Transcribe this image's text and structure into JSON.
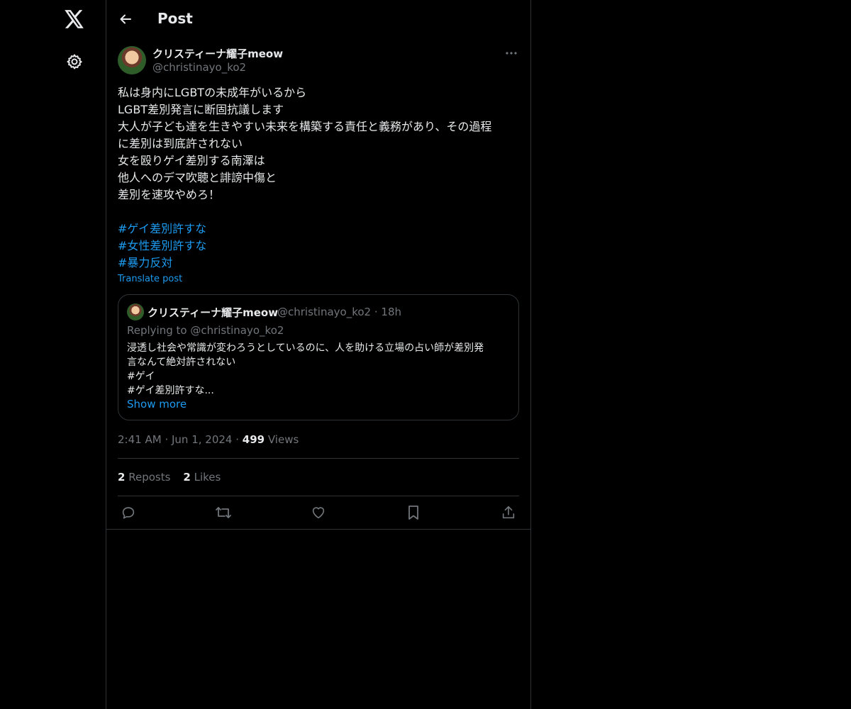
{
  "nav": {
    "logo_icon": "x-logo-icon",
    "settings_icon": "gear-icon"
  },
  "header": {
    "back_icon": "arrow-left-icon",
    "title": "Post"
  },
  "post": {
    "author_name": "クリスティーナ耀子meow",
    "author_handle": "@christinayo_ko2",
    "more_icon": "more-horizontal-icon",
    "lines": [
      "私は身内にLGBTの未成年がいるから",
      "LGBT差別発言に断固抗議します",
      "大人が子ども達を生きやすい未来を構築する責任と義務があり、その過程",
      "に差別は到底許されない",
      "女を殴りゲイ差別する南澤は",
      "他人へのデマ吹聴と誹謗中傷と",
      "差別を速攻やめろ！"
    ],
    "hashtags": [
      "#ゲイ差別許すな",
      "#女性差別許すな",
      "#暴力反対"
    ],
    "translate_label": "Translate post",
    "time": "2:41 AM",
    "date": "Jun 1, 2024",
    "views_count": "499",
    "views_label": "Views",
    "reposts_count": "2",
    "reposts_label": "Reposts",
    "likes_count": "2",
    "likes_label": "Likes"
  },
  "quote": {
    "author_name": "クリスティーナ耀子meow",
    "author_handle": "@christinayo_ko2",
    "age": "18h",
    "replying_to": "Replying to @christinayo_ko2",
    "lines": [
      "浸透し社会や常識が変わろうとしているのに、人を助ける立場の占い師が差別発",
      "言なんて絶対許されない",
      "#ゲイ",
      "#ゲイ差別許すな..."
    ],
    "show_more": "Show more"
  },
  "actions": [
    "reply-icon",
    "repost-icon",
    "like-icon",
    "bookmark-icon",
    "share-icon"
  ],
  "colors": {
    "background": "#000000",
    "text": "#e7e9ea",
    "muted": "#71767b",
    "accent": "#1d9bf0",
    "border": "#2f3336"
  }
}
